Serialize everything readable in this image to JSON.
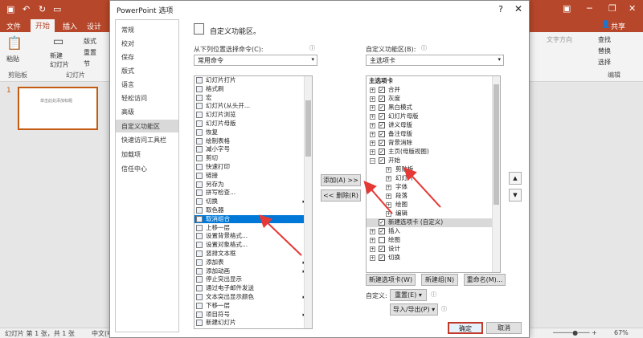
{
  "app": {
    "tabs": [
      "文件",
      "开始",
      "插入",
      "设计"
    ],
    "share": "共享",
    "ribbon": {
      "paste": "粘贴",
      "clipboard": "剪贴板",
      "new_slide": "新建\n幻灯片",
      "slides": "幻灯片",
      "layout": "版式",
      "reset": "重置",
      "section": "节",
      "text_direction": "文字方向",
      "find": "查找",
      "replace": "替换",
      "select": "选择",
      "editing": "编辑"
    },
    "slide_number": "1",
    "thumb_text": "单击此处添加标题",
    "status": {
      "slide_info": "幻灯片 第 1 张，共 1 张",
      "language": "中文(中",
      "zoom": "67%"
    }
  },
  "dialog": {
    "title": "PowerPoint 选项",
    "help": "?",
    "close": "✕",
    "nav": [
      "常规",
      "校对",
      "保存",
      "版式",
      "语言",
      "轻松访问",
      "高级",
      "自定义功能区",
      "快速访问工具栏",
      "加载项",
      "信任中心"
    ],
    "selected_nav": "自定义功能区",
    "heading": "自定义功能区。",
    "choose_label": "从下列位置选择命令(C):",
    "choose_value": "常用命令",
    "customize_label": "自定义功能区(B):",
    "customize_value": "主选项卡",
    "commands": [
      {
        "label": "幻灯片打片",
        "sub": false
      },
      {
        "label": "格式刷",
        "sub": false
      },
      {
        "label": "宏",
        "sub": false
      },
      {
        "label": "幻灯片(从头开...",
        "sub": false
      },
      {
        "label": "幻灯片浏览",
        "sub": false
      },
      {
        "label": "幻灯片母版",
        "sub": false
      },
      {
        "label": "恢复",
        "sub": false
      },
      {
        "label": "绘制表格",
        "sub": false
      },
      {
        "label": "减小字号",
        "sub": false
      },
      {
        "label": "剪切",
        "sub": false
      },
      {
        "label": "快速打印",
        "sub": false
      },
      {
        "label": "链接",
        "sub": false
      },
      {
        "label": "另存为",
        "sub": false
      },
      {
        "label": "拼写检查...",
        "sub": false
      },
      {
        "label": "切换",
        "sub": true
      },
      {
        "label": "取色器",
        "sub": false
      },
      {
        "label": "取消组合",
        "sub": false,
        "selected": true
      },
      {
        "label": "上移一层",
        "sub": false
      },
      {
        "label": "设置背景格式...",
        "sub": false
      },
      {
        "label": "设置对象格式...",
        "sub": false
      },
      {
        "label": "竖排文本框",
        "sub": false
      },
      {
        "label": "添加表",
        "sub": true
      },
      {
        "label": "添加动画",
        "sub": true
      },
      {
        "label": "停止突出显示",
        "sub": false
      },
      {
        "label": "通过电子邮件发送",
        "sub": false
      },
      {
        "label": "文本突出显示颜色",
        "sub": true
      },
      {
        "label": "下移一层",
        "sub": false
      },
      {
        "label": "项目符号",
        "sub": true
      },
      {
        "label": "新建幻灯片",
        "sub": false
      }
    ],
    "add_button": "添加(A) >>",
    "remove_button": "<< 删除(R)",
    "tree_header": "主选项卡",
    "tree": [
      {
        "label": "合并",
        "level": 0,
        "pm": "+",
        "checked": true
      },
      {
        "label": "灰度",
        "level": 0,
        "pm": "+",
        "checked": true
      },
      {
        "label": "黑白模式",
        "level": 0,
        "pm": "+",
        "checked": true
      },
      {
        "label": "幻灯片母版",
        "level": 0,
        "pm": "+",
        "checked": true
      },
      {
        "label": "讲义母版",
        "level": 0,
        "pm": "+",
        "checked": true
      },
      {
        "label": "备注母版",
        "level": 0,
        "pm": "+",
        "checked": true
      },
      {
        "label": "背景消除",
        "level": 0,
        "pm": "+",
        "checked": true
      },
      {
        "label": "主页(母版视图)",
        "level": 0,
        "pm": "+",
        "checked": true
      },
      {
        "label": "开始",
        "level": 0,
        "pm": "−",
        "checked": true
      },
      {
        "label": "剪贴板",
        "level": 1,
        "pm": "+",
        "checked": null
      },
      {
        "label": "幻灯片",
        "level": 1,
        "pm": "+",
        "checked": null
      },
      {
        "label": "字体",
        "level": 1,
        "pm": "+",
        "checked": null
      },
      {
        "label": "段落",
        "level": 1,
        "pm": "+",
        "checked": null
      },
      {
        "label": "绘图",
        "level": 1,
        "pm": "+",
        "checked": null
      },
      {
        "label": "编辑",
        "level": 1,
        "pm": "+",
        "checked": null
      },
      {
        "label": "新建选项卡 (自定义)",
        "level": 0,
        "pm": "",
        "checked": true,
        "highlight": true
      },
      {
        "label": "插入",
        "level": 0,
        "pm": "+",
        "checked": true
      },
      {
        "label": "绘图",
        "level": 0,
        "pm": "+",
        "checked": false
      },
      {
        "label": "设计",
        "level": 0,
        "pm": "+",
        "checked": true
      },
      {
        "label": "切换",
        "level": 0,
        "pm": "+",
        "checked": true
      }
    ],
    "new_tab_button": "新建选项卡(W)",
    "new_group_button": "新建组(N)",
    "rename_button": "重命名(M)...",
    "customize_text": "自定义:",
    "reset_button": "重置(E) ▾",
    "import_export_button": "导入/导出(P) ▾",
    "ok_button": "确定",
    "cancel_button": "取消"
  },
  "colors": {
    "brand": "#b7472a",
    "selection": "#0078d7",
    "arrow": "#e53935"
  }
}
